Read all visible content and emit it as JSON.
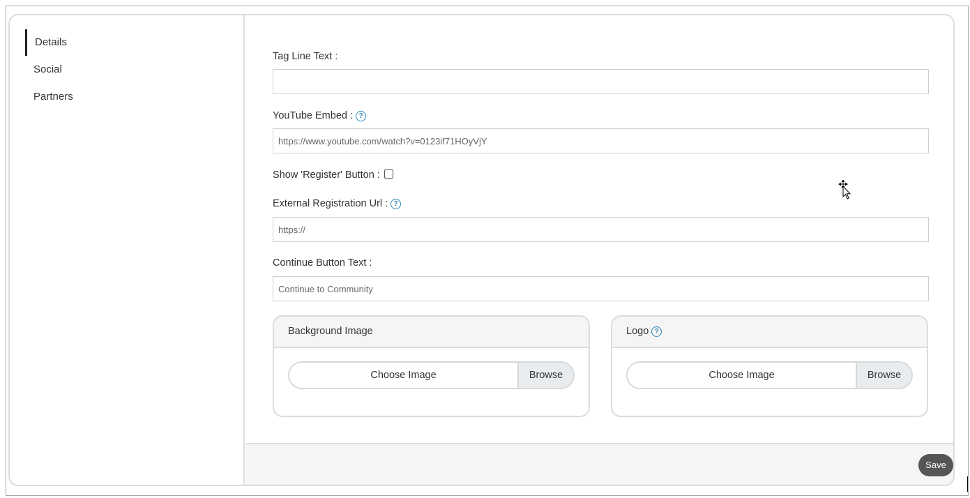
{
  "sidebar": {
    "items": [
      {
        "label": "Details",
        "active": true
      },
      {
        "label": "Social",
        "active": false
      },
      {
        "label": "Partners",
        "active": false
      }
    ]
  },
  "form": {
    "tagline": {
      "label": "Tag Line Text :",
      "value": "",
      "placeholder": ""
    },
    "youtube": {
      "label": "YouTube Embed :",
      "value": "",
      "placeholder": "https://www.youtube.com/watch?v=0123if71HOyVjY",
      "help_icon": "question-circle-icon"
    },
    "register": {
      "label": "Show 'Register' Button :",
      "checked": false
    },
    "external_url": {
      "label": "External Registration Url :",
      "value": "",
      "placeholder": "https://",
      "help_icon": "question-circle-icon"
    },
    "continue_text": {
      "label": "Continue Button Text :",
      "value": "",
      "placeholder": "Continue to Community"
    }
  },
  "cards": {
    "background": {
      "title": "Background Image",
      "choose_label": "Choose Image",
      "browse_label": "Browse"
    },
    "logo": {
      "title": "Logo",
      "choose_label": "Choose Image",
      "browse_label": "Browse",
      "help_icon": "question-circle-icon"
    }
  },
  "footer": {
    "save_label": "Save"
  },
  "colors": {
    "help_icon": "#2d8ab8",
    "save_button_bg": "#555555",
    "border": "#dcdcdc",
    "header_bg": "#f5f5f5"
  }
}
